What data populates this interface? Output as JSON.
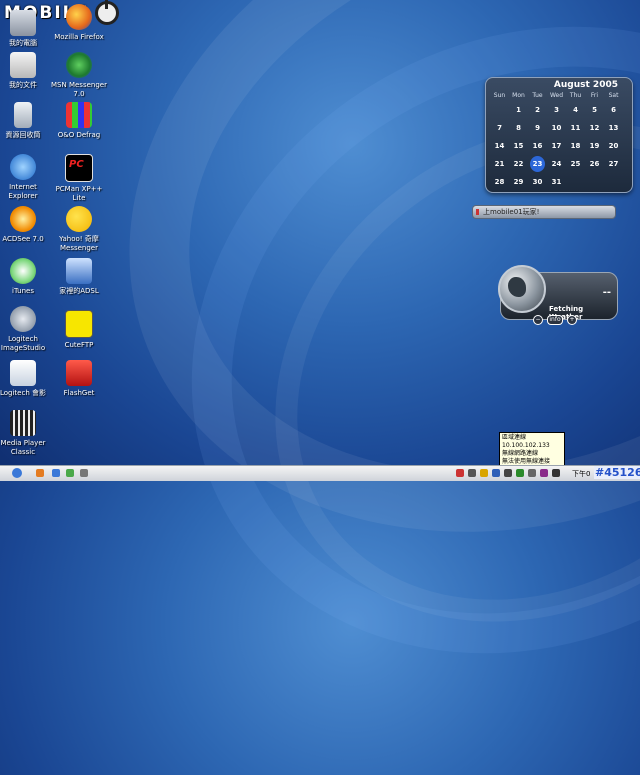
{
  "brand": {
    "logo_text": "MOBILE"
  },
  "desktop_icons": [
    {
      "label": "我的電腦"
    },
    {
      "label": "Mozilla Firefox"
    },
    {
      "label": "我的文件"
    },
    {
      "label": "MSN Messenger 7.0"
    },
    {
      "label": "資源回收筒"
    },
    {
      "label": "O&O Defrag"
    },
    {
      "label": "Internet Explorer"
    },
    {
      "label": "PCMan XP++ Lite"
    },
    {
      "label": "ACDSee 7.0"
    },
    {
      "label": "Yahoo! 奇摩 Messenger"
    },
    {
      "label": "iTunes"
    },
    {
      "label": "家裡的ADSL"
    },
    {
      "label": "Logitech ImageStudio"
    },
    {
      "label": "CuteFTP"
    },
    {
      "label": "Logitech 會影"
    },
    {
      "label": "FlashGet"
    },
    {
      "label": "Media Player Classic"
    }
  ],
  "calendar": {
    "title": "August 2005",
    "days_of_week": [
      "Sun",
      "Mon",
      "Tue",
      "Wed",
      "Thu",
      "Fri",
      "Sat"
    ],
    "weeks": [
      [
        "",
        "1",
        "2",
        "3",
        "4",
        "5",
        "6"
      ],
      [
        "7",
        "8",
        "9",
        "10",
        "11",
        "12",
        "13"
      ],
      [
        "14",
        "15",
        "16",
        "17",
        "18",
        "19",
        "20"
      ],
      [
        "21",
        "22",
        "23",
        "24",
        "25",
        "26",
        "27"
      ],
      [
        "28",
        "29",
        "30",
        "31",
        "",
        "",
        ""
      ]
    ],
    "today": "23",
    "accent": "#2c67d8"
  },
  "ticker": {
    "text": "上mobile01玩家!"
  },
  "weather": {
    "status": "Fetching Weather",
    "temp_placeholder": "--",
    "buttons": [
      "−",
      "info",
      "+"
    ]
  },
  "tooltip": {
    "lines": [
      "區域連線",
      "10.100.102.133",
      "無線網路連線",
      "無法使用無線連接"
    ]
  },
  "taskbar": {
    "clock": "下午0",
    "tag": "#45126"
  }
}
